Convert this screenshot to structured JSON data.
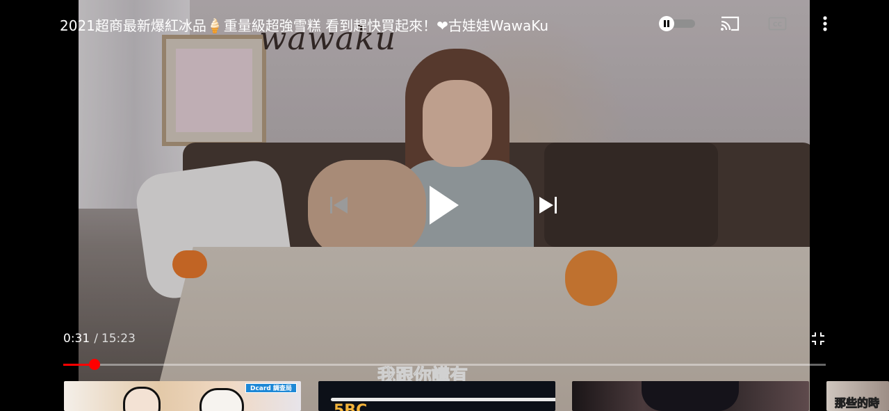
{
  "video": {
    "title": "2021超商最新爆紅冰品🍦重量級超強雪糕 看到趕快買起來！❤古娃娃WawaKu",
    "watermark": "wawaku",
    "caption": "我跟你講有"
  },
  "controls": {
    "current_time": "0:31",
    "separator": "/",
    "duration": "15:23",
    "progress_fraction": 0.041,
    "autoplay_icon": "pause-icon",
    "cast_icon": "cast-icon",
    "captions_icon": "cc-icon",
    "captions_label": "CC",
    "more_icon": "more-vert-icon",
    "previous_icon": "skip-previous-icon",
    "play_icon": "play-icon",
    "next_icon": "skip-next-icon",
    "fullscreen_icon": "exit-fullscreen-icon"
  },
  "related": [
    {
      "badge": "Dcard 調查局"
    },
    {
      "text": "5BC"
    },
    {},
    {
      "text": "那些的時"
    }
  ],
  "colors": {
    "progress_played": "#ff0000",
    "progress_track": "rgba(255,255,255,0.4)",
    "background": "#000000"
  }
}
